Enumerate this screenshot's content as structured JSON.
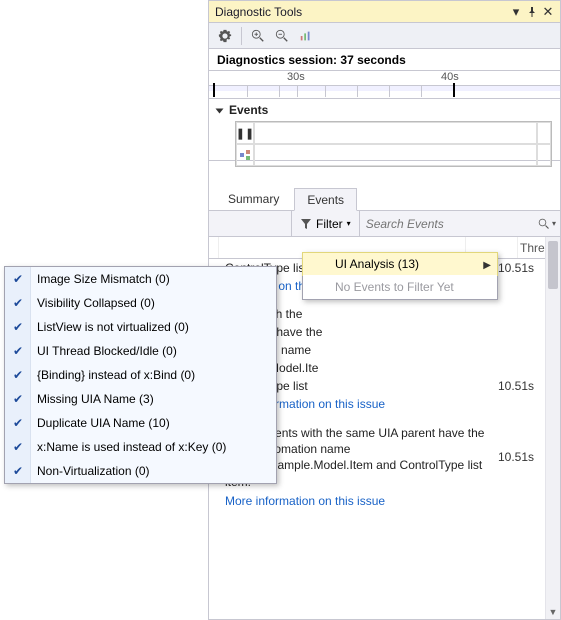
{
  "window": {
    "title": "Diagnostic Tools"
  },
  "session": {
    "label": "Diagnostics session:",
    "value": "37 seconds"
  },
  "ruler": {
    "ticks": [
      "30s",
      "40s"
    ]
  },
  "events_band": {
    "title": "Events"
  },
  "tabs": {
    "summary": "Summary",
    "events": "Events"
  },
  "filter": {
    "label": "Filter",
    "search_placeholder": "Search Events"
  },
  "filter_dropdown": {
    "item_ui_analysis": "UI Analysis (13)",
    "item_no_events": "No Events to Filter Yet"
  },
  "submenu_items": [
    "Image Size Mismatch (0)",
    "Visibility Collapsed (0)",
    "ListView is not virtualized (0)",
    "UI Thread Blocked/Idle (0)",
    "{Binding} instead of x:Bind (0)",
    "Missing UIA Name (3)",
    "Duplicate UIA Name (10)",
    "x:Name is used instead of x:Key (0)",
    "Non-Virtualization (0)"
  ],
  "columns": {
    "time": "",
    "thread": "Thread"
  },
  "rows": {
    "r1": {
      "text_frag": "ControlType list",
      "time": "10.51s",
      "link": "formation on this"
    },
    "r2": {
      "text1": "ments with the",
      "text2": "IA parent have the",
      "text3": "utomation name",
      "text4": "Sample.Model.Ite",
      "text5": "ControlType list",
      "time": "10.51s",
      "link": "More information on this issue"
    },
    "r3": {
      "text": "UIA Elements with the same UIA parent have the same automation name ListViewSample.Model.Item and ControlType list item.",
      "time": "10.51s",
      "link": "More information on this issue"
    }
  }
}
